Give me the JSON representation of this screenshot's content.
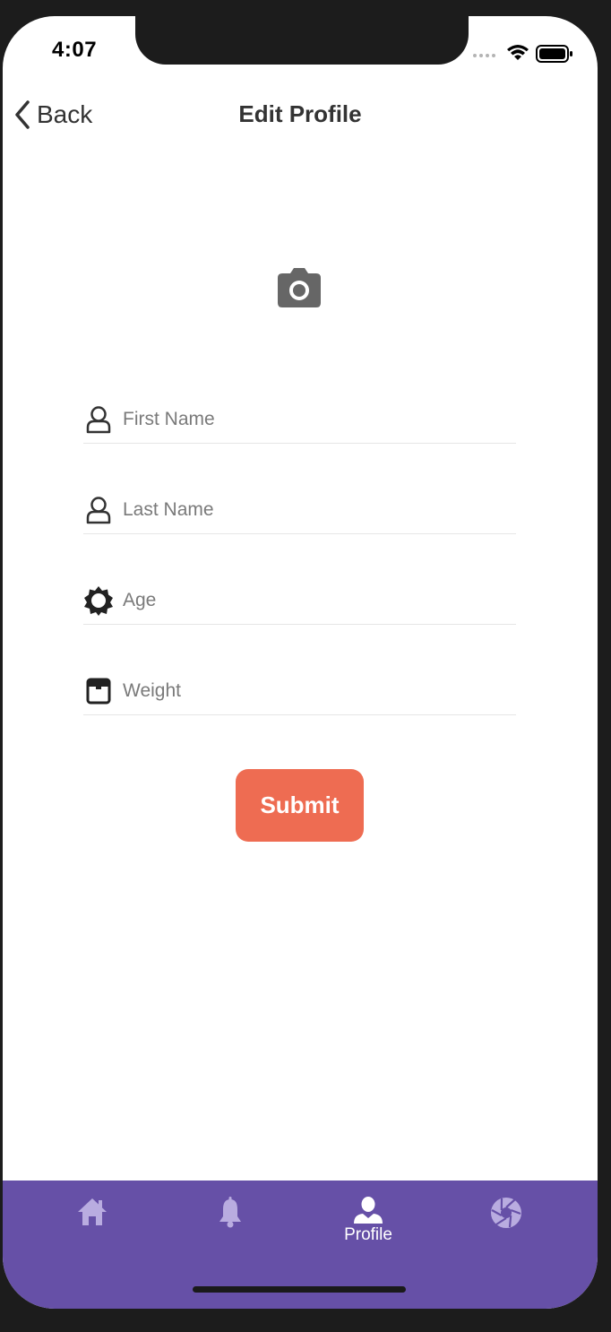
{
  "status_bar": {
    "time": "4:07"
  },
  "nav": {
    "back_label": "Back",
    "title": "Edit Profile"
  },
  "form": {
    "first_name": {
      "placeholder": "First Name",
      "icon": "user-outline-icon"
    },
    "last_name": {
      "placeholder": "Last Name",
      "icon": "user-outline-icon"
    },
    "age": {
      "placeholder": "Age",
      "icon": "sun-gear-icon"
    },
    "weight": {
      "placeholder": "Weight",
      "icon": "scale-icon"
    },
    "submit_label": "Submit"
  },
  "tabbar": {
    "background": "#6650a7",
    "tabs": [
      {
        "name": "home",
        "label": "",
        "icon": "home-icon",
        "active": false
      },
      {
        "name": "notifications",
        "label": "",
        "icon": "bell-icon",
        "active": false
      },
      {
        "name": "profile",
        "label": "Profile",
        "icon": "person-icon",
        "active": true
      },
      {
        "name": "camera",
        "label": "",
        "icon": "aperture-icon",
        "active": false
      }
    ]
  },
  "colors": {
    "accent": "#ee6c52",
    "tabbar": "#6650a7",
    "inactive_icon": "#b9ace0"
  }
}
